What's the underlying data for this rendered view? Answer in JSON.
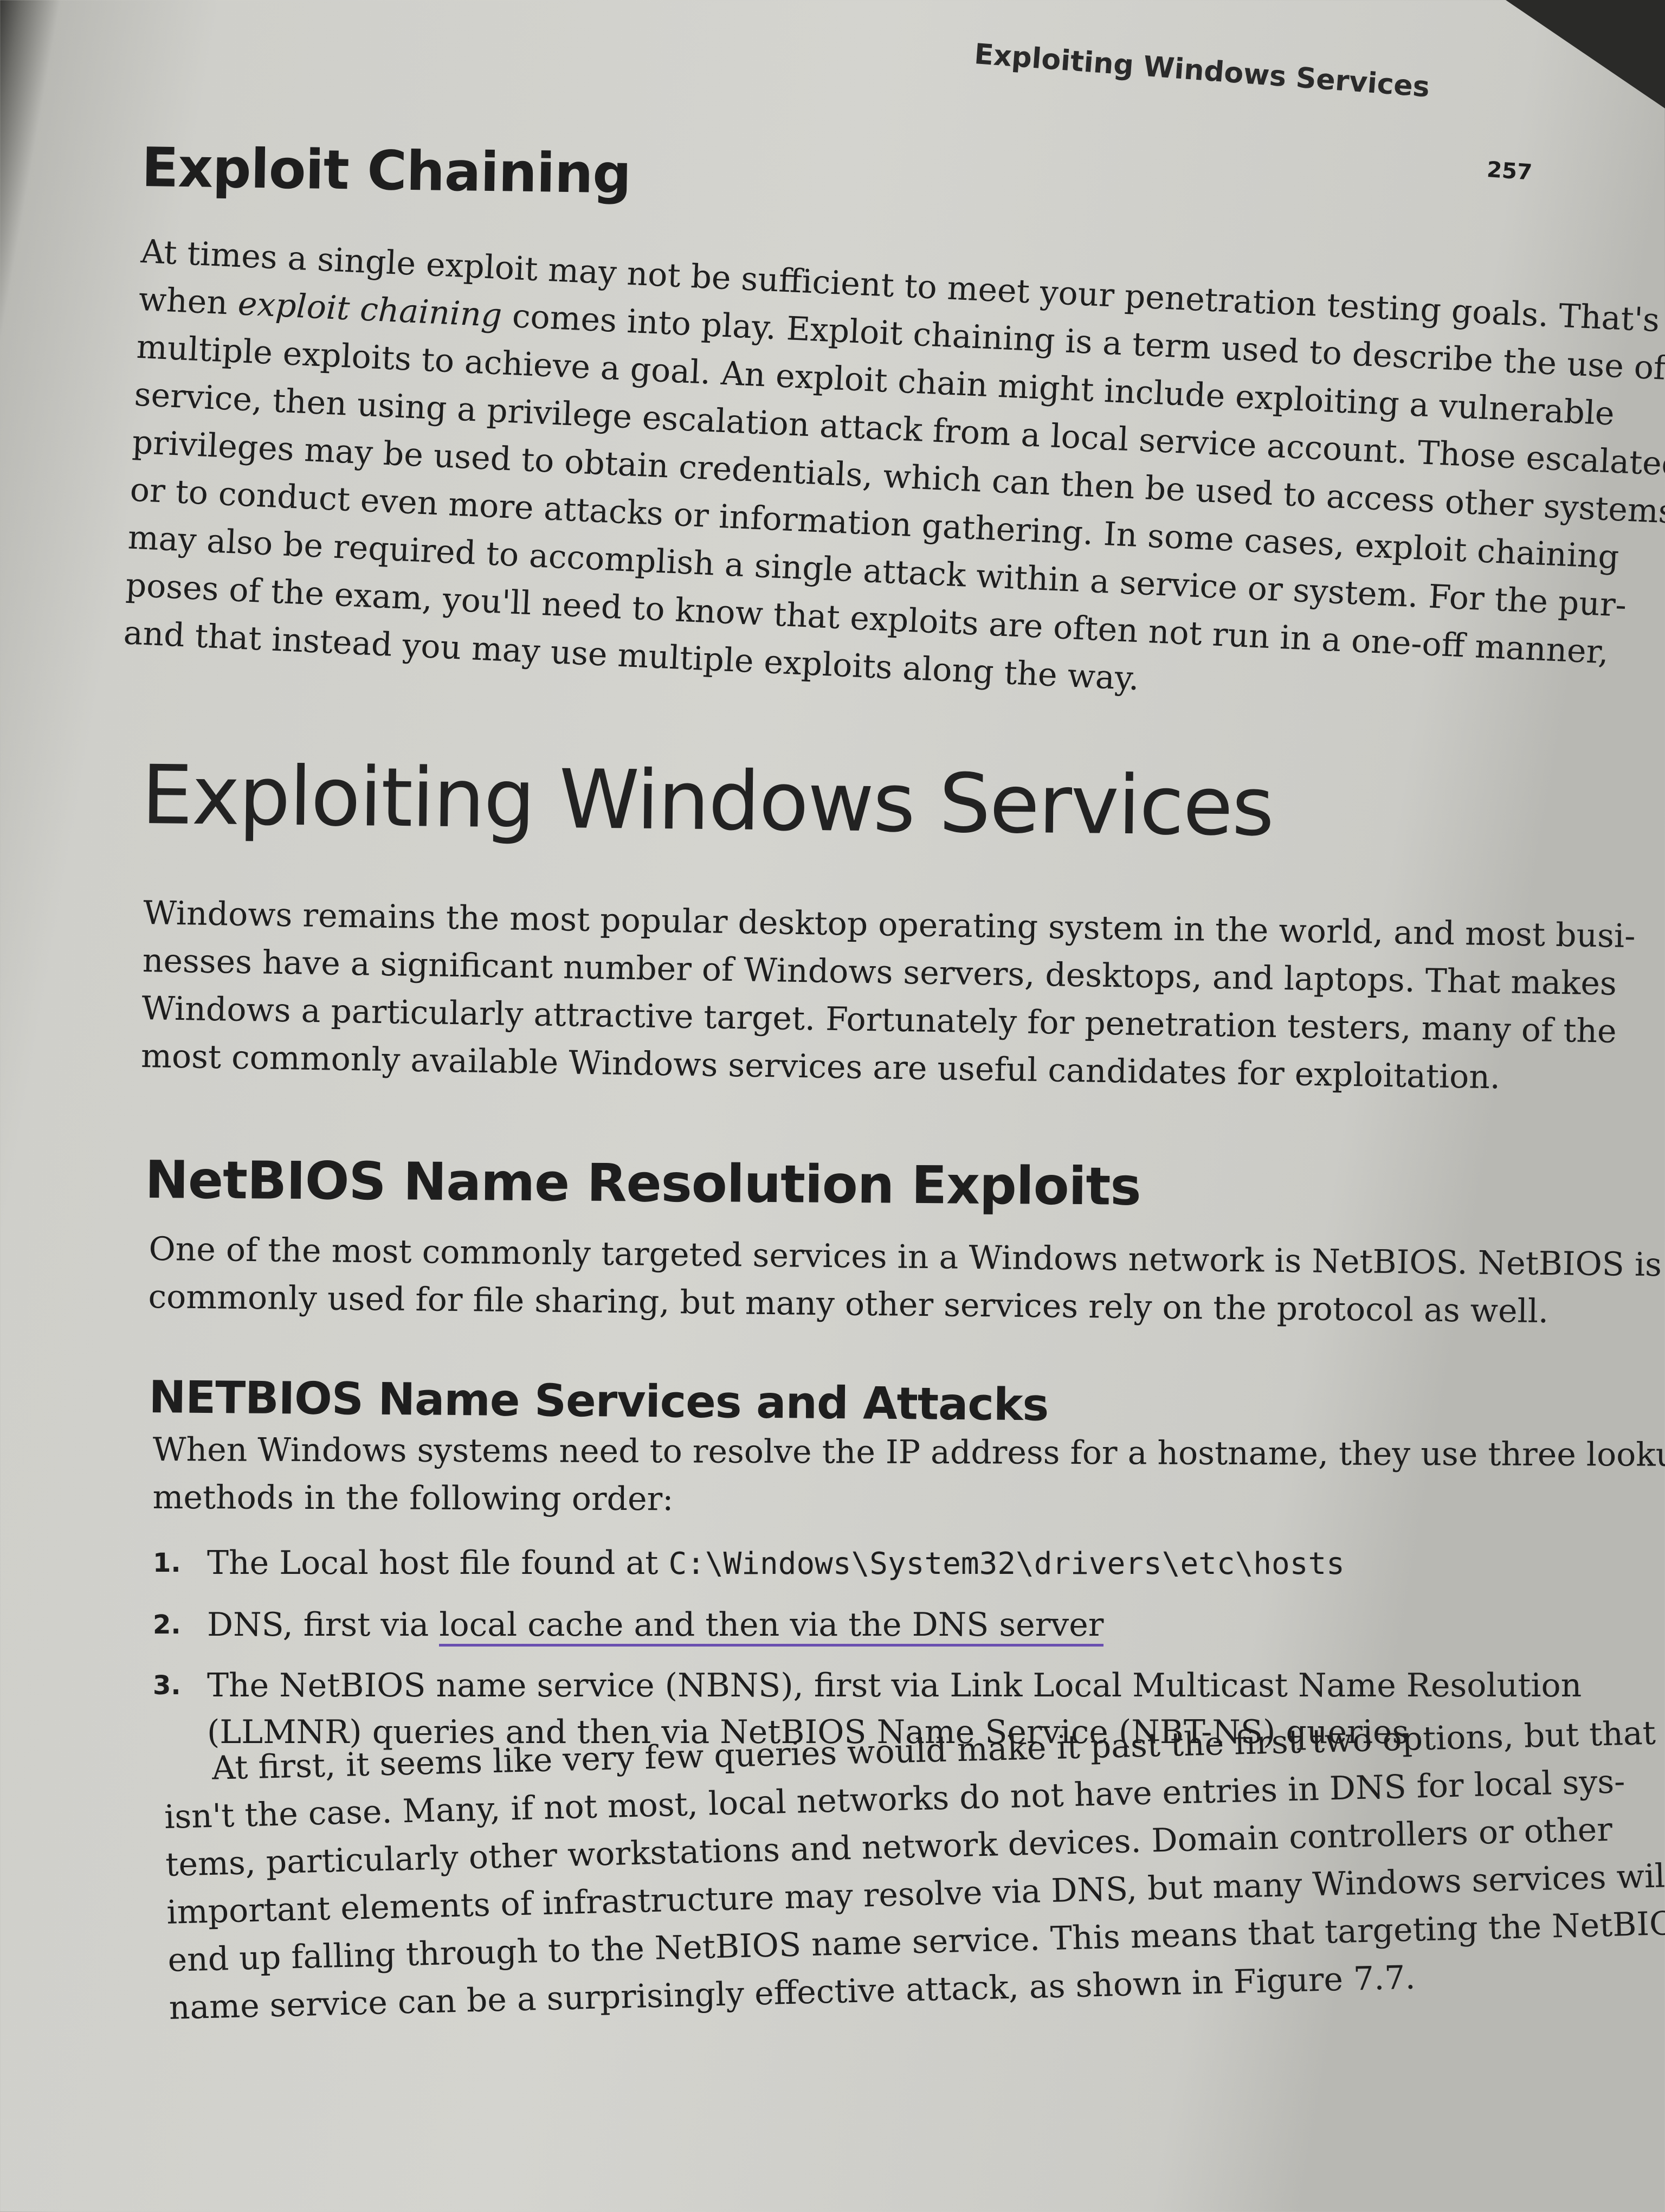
{
  "running_header": "Exploiting Windows Services",
  "page_number": "257",
  "sections": {
    "exploit_chaining": {
      "heading": "Exploit Chaining",
      "lines": [
        "At times a single exploit may not be sufficient to meet your penetration testing goals. That's",
        "when exploit chaining comes into play. Exploit chaining is a term used to describe the use of",
        "multiple exploits to achieve a goal. An exploit chain might include exploiting a vulnerable",
        "service, then using a privilege escalation attack from a local service account. Those escalated",
        "privileges may be used to obtain credentials, which can then be used to access other systems",
        "or to conduct even more attacks or information gathering. In some cases, exploit chaining",
        "may also be required to accomplish a single attack within a service or system. For the pur-",
        "poses of the exam, you'll need to know that exploits are often not run in a one-off manner,",
        "and that instead you may use multiple exploits along the way."
      ]
    },
    "windows_services": {
      "heading": "Exploiting Windows Services",
      "lines": [
        "Windows remains the most popular desktop operating system in the world, and most busi-",
        "nesses have a significant number of Windows servers, desktops, and laptops. That makes",
        "Windows a particularly attractive target. Fortunately for penetration testers, many of the",
        "most commonly available Windows services are useful candidates for exploitation."
      ]
    },
    "netbios_exploits": {
      "heading": "NetBIOS Name Resolution Exploits",
      "lines": [
        "One of the most commonly targeted services in a Windows network is NetBIOS. NetBIOS is",
        "commonly used for file sharing, but many other services rely on the protocol as well."
      ]
    },
    "netbios_attacks": {
      "heading": "NETBIOS Name Services and Attacks",
      "lines": [
        "When Windows systems need to resolve the IP address for a hostname, they use three lookup",
        "methods in the following order:"
      ],
      "list": [
        {
          "num": "1.",
          "text": "The Local host file found at ",
          "code": "C:\\Windows\\System32\\drivers\\etc\\hosts"
        },
        {
          "num": "2.",
          "text_before": "DNS, first via ",
          "underlined": "local cache and then via the DNS server"
        },
        {
          "num": "3.",
          "line1": "The NetBIOS name service (NBNS), first via Link Local Multicast Name Resolution",
          "line2": "(LLMNR) queries and then via NetBIOS Name Service (NBT-NS) queries"
        }
      ],
      "closing_lines": [
        "At first, it seems like very few queries would make it past the first two options, but that",
        "isn't the case. Many, if not most, local networks do not have entries in DNS for local sys-",
        "tems, particularly other workstations and network devices. Domain controllers or other",
        "important elements of infrastructure may resolve via DNS, but many Windows services will",
        "end up falling through to the NetBIOS name service. This means that targeting the NetBIOS",
        "name service can be a surprisingly effective attack, as shown in Figure 7.7."
      ]
    }
  },
  "colors": {
    "pen_underline": "#6a4fb0",
    "paper": "#d0d0cb",
    "ink": "#1e1e1e"
  }
}
